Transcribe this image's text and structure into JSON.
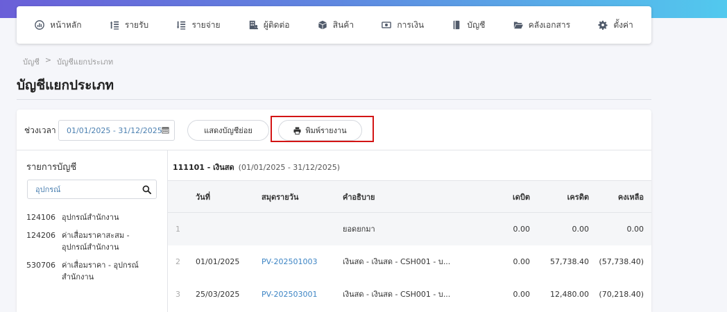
{
  "nav": {
    "items": [
      {
        "label": "หน้าหลัก",
        "icon": "dashboard-icon"
      },
      {
        "label": "รายรับ",
        "icon": "income-icon"
      },
      {
        "label": "รายจ่าย",
        "icon": "expense-icon"
      },
      {
        "label": "ผู้ติดต่อ",
        "icon": "contacts-icon"
      },
      {
        "label": "สินค้า",
        "icon": "box-icon"
      },
      {
        "label": "การเงิน",
        "icon": "money-icon"
      },
      {
        "label": "บัญชี",
        "icon": "book-icon"
      },
      {
        "label": "คลังเอกสาร",
        "icon": "folder-icon"
      },
      {
        "label": "ตั้งค่า",
        "icon": "gear-icon"
      }
    ]
  },
  "breadcrumb": {
    "root": "บัญชี",
    "separator": ">",
    "current": "บัญชีแยกประเภท"
  },
  "page_title": "บัญชีแยกประเภท",
  "toolbar": {
    "period_label": "ช่วงเวลา",
    "date_range": "01/01/2025 - 31/12/2025",
    "show_sub_label": "แสดงบัญชีย่อย",
    "print_label": "พิมพ์รายงาน"
  },
  "sidebar": {
    "title": "รายการบัญชี",
    "search_value": "อุปกรณ์",
    "accounts": [
      {
        "code": "124106",
        "name": "อุปกรณ์สำนักงาน"
      },
      {
        "code": "124206",
        "name": "ค่าเสื่อมราคาสะสม - อุปกรณ์สำนักงาน"
      },
      {
        "code": "530706",
        "name": "ค่าเสื่อมราคา - อุปกรณ์สำนักงาน"
      }
    ]
  },
  "ledger": {
    "account_title": "111101 - เงินสด",
    "account_range": "(01/01/2025 - 31/12/2025)",
    "columns": {
      "no": "",
      "date": "วันที่",
      "journal": "สมุดรายวัน",
      "description": "คำอธิบาย",
      "debit": "เดบิต",
      "credit": "เครดิต",
      "balance": "คงเหลือ"
    },
    "rows": [
      {
        "no": "1",
        "date": "",
        "journal": "",
        "description": "ยอดยกมา",
        "debit": "0.00",
        "credit": "0.00",
        "balance": "0.00"
      },
      {
        "no": "2",
        "date": "01/01/2025",
        "journal": "PV-202501003",
        "description": "เงินสด - เงินสด - CSH001 - บ...",
        "debit": "0.00",
        "credit": "57,738.40",
        "balance": "(57,738.40)"
      },
      {
        "no": "3",
        "date": "25/03/2025",
        "journal": "PV-202503001",
        "description": "เงินสด - เงินสด - CSH001 - บ...",
        "debit": "0.00",
        "credit": "12,480.00",
        "balance": "(70,218.40)"
      }
    ]
  }
}
